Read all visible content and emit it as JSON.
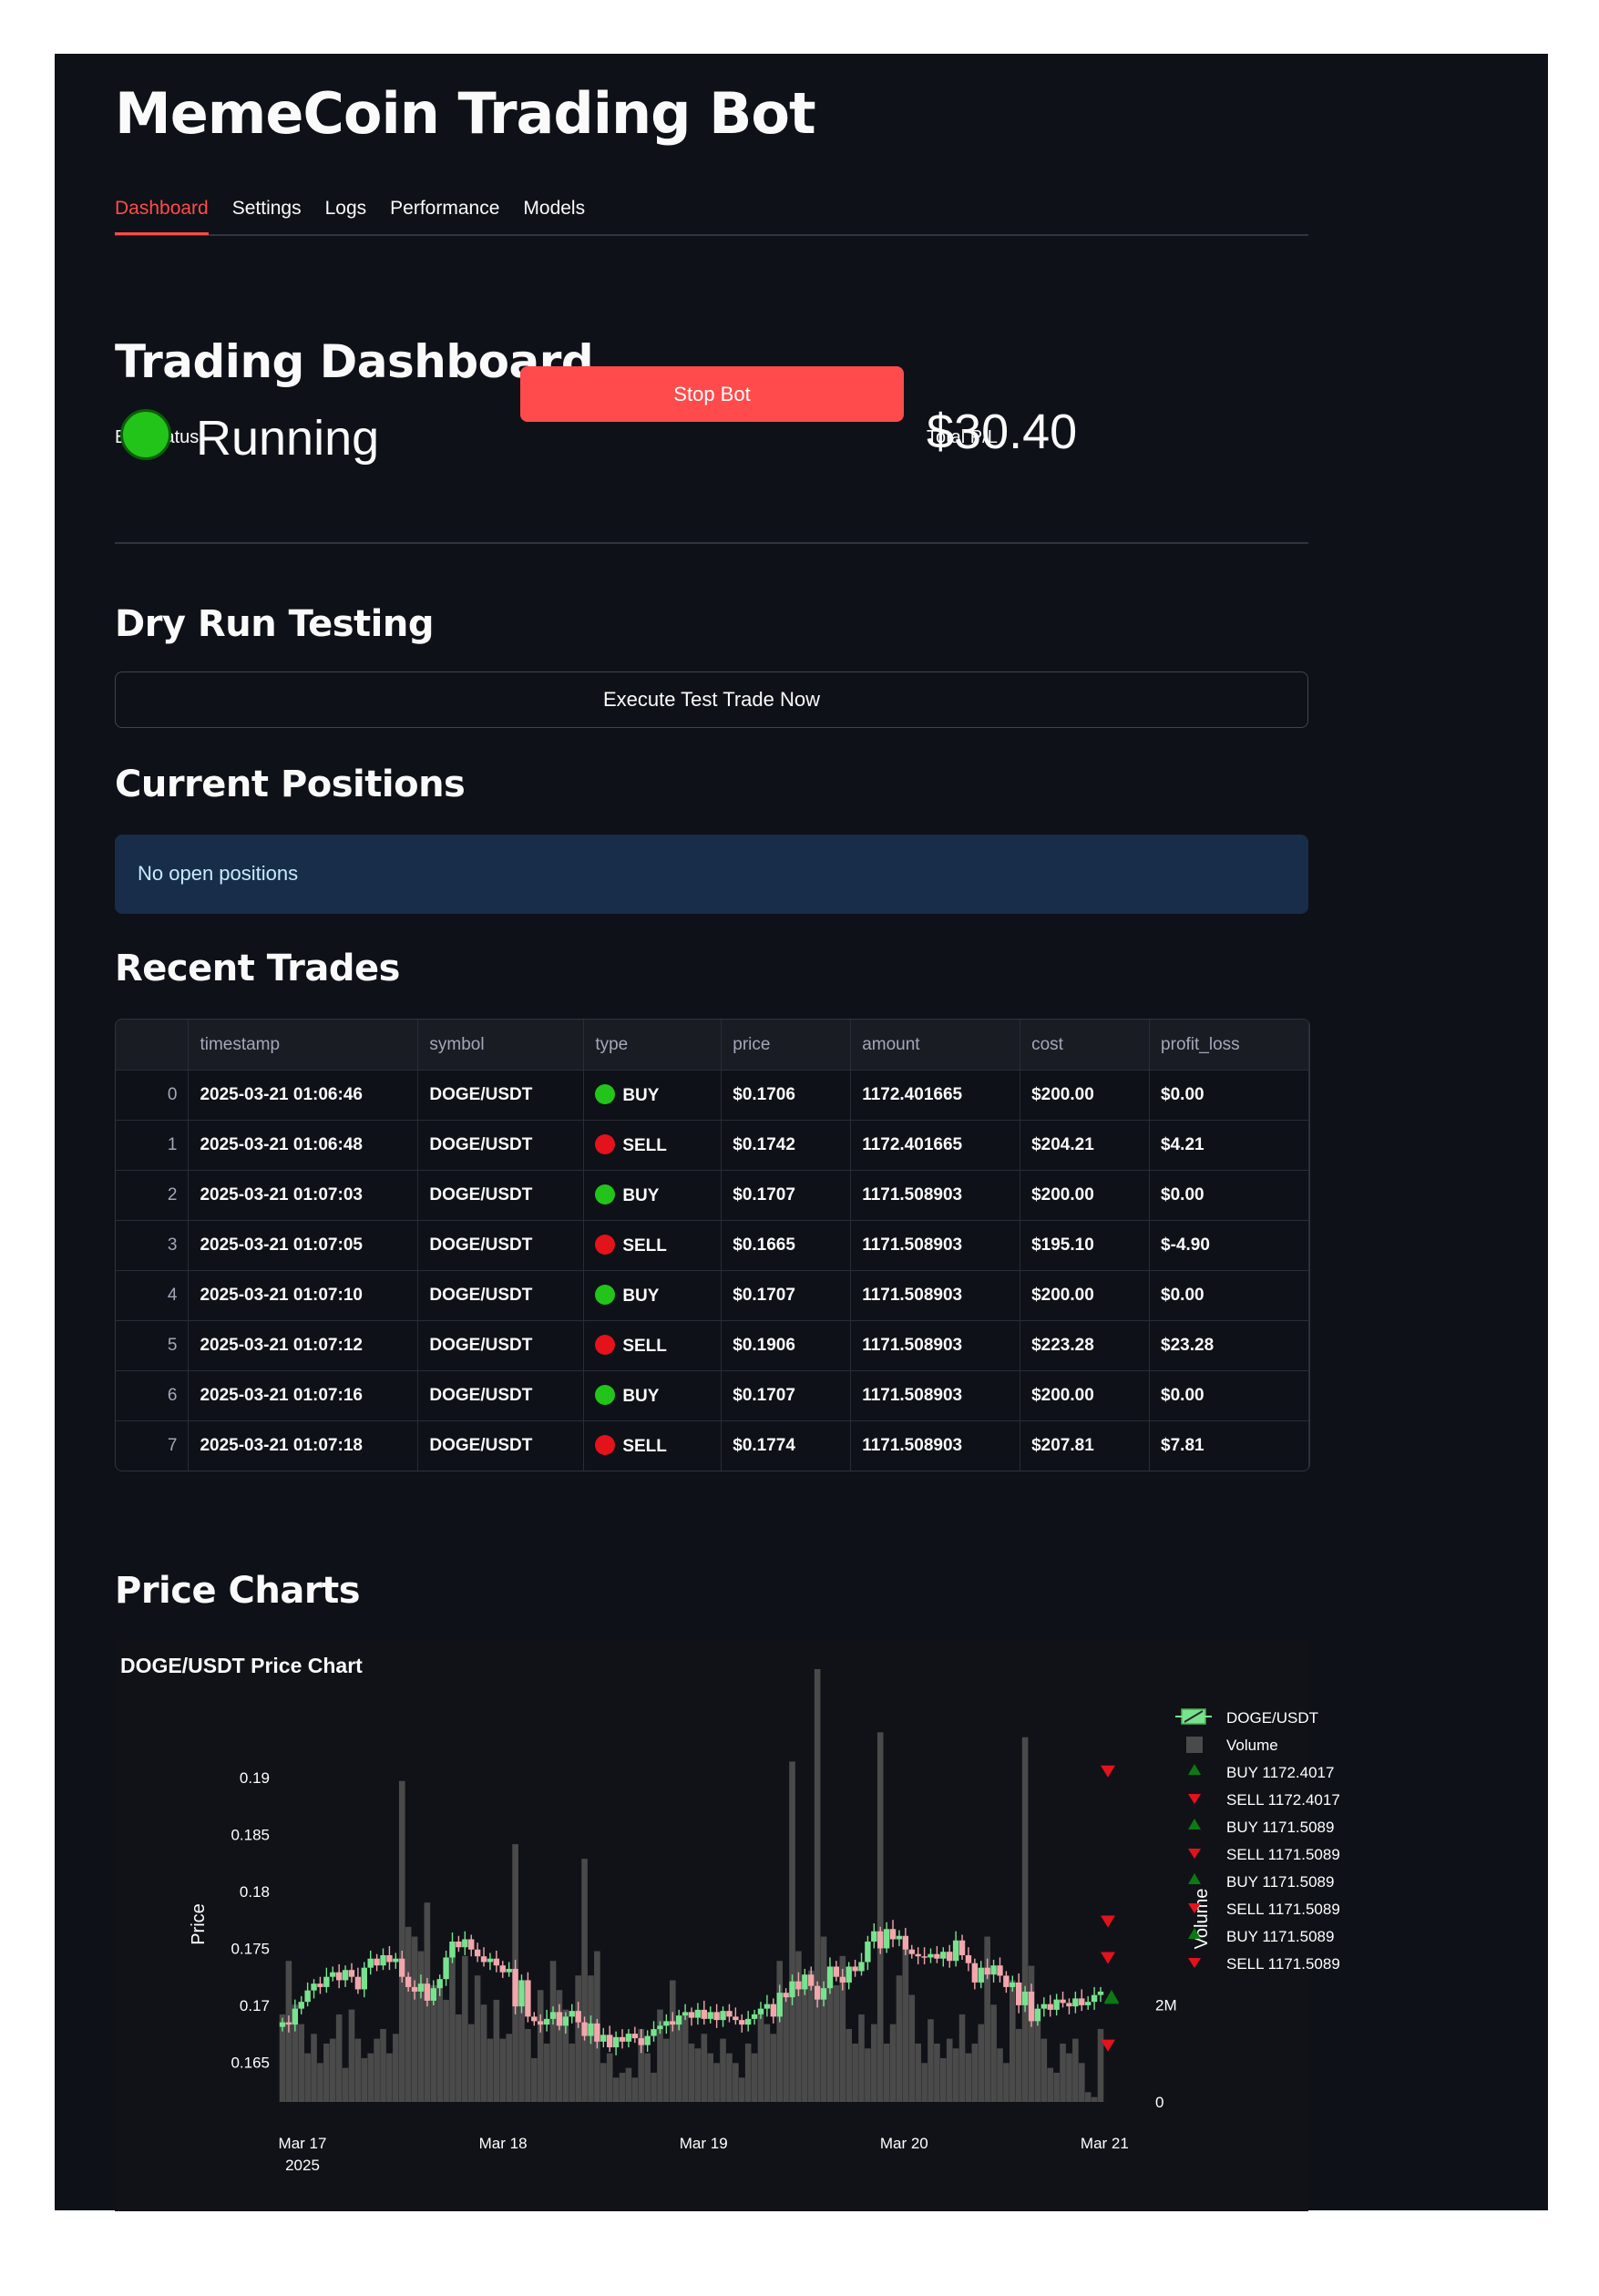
{
  "app": {
    "title": "MemeCoin Trading Bot"
  },
  "tabs": [
    {
      "label": "Dashboard",
      "active": true
    },
    {
      "label": "Settings",
      "active": false
    },
    {
      "label": "Logs",
      "active": false
    },
    {
      "label": "Performance",
      "active": false
    },
    {
      "label": "Models",
      "active": false
    }
  ],
  "dashboard": {
    "heading": "Trading Dashboard",
    "bot_status_label": "Bot Status",
    "bot_status_value": "Running",
    "status_color": "#22c419",
    "stop_button_label": "Stop Bot",
    "total_pl_label": "Total P/L",
    "total_pl_value": "$30.40"
  },
  "dry_run": {
    "heading": "Dry Run Testing",
    "button_label": "Execute Test Trade Now"
  },
  "positions": {
    "heading": "Current Positions",
    "empty_message": "No open positions"
  },
  "trades": {
    "heading": "Recent Trades",
    "columns": [
      "",
      "timestamp",
      "symbol",
      "type",
      "price",
      "amount",
      "cost",
      "profit_loss"
    ],
    "rows": [
      [
        "0",
        "2025-03-21 01:06:46",
        "DOGE/USDT",
        "BUY",
        "$0.1706",
        "1172.401665",
        "$200.00",
        "$0.00"
      ],
      [
        "1",
        "2025-03-21 01:06:48",
        "DOGE/USDT",
        "SELL",
        "$0.1742",
        "1172.401665",
        "$204.21",
        "$4.21"
      ],
      [
        "2",
        "2025-03-21 01:07:03",
        "DOGE/USDT",
        "BUY",
        "$0.1707",
        "1171.508903",
        "$200.00",
        "$0.00"
      ],
      [
        "3",
        "2025-03-21 01:07:05",
        "DOGE/USDT",
        "SELL",
        "$0.1665",
        "1171.508903",
        "$195.10",
        "$-4.90"
      ],
      [
        "4",
        "2025-03-21 01:07:10",
        "DOGE/USDT",
        "BUY",
        "$0.1707",
        "1171.508903",
        "$200.00",
        "$0.00"
      ],
      [
        "5",
        "2025-03-21 01:07:12",
        "DOGE/USDT",
        "SELL",
        "$0.1906",
        "1171.508903",
        "$223.28",
        "$23.28"
      ],
      [
        "6",
        "2025-03-21 01:07:16",
        "DOGE/USDT",
        "BUY",
        "$0.1707",
        "1171.508903",
        "$200.00",
        "$0.00"
      ],
      [
        "7",
        "2025-03-21 01:07:18",
        "DOGE/USDT",
        "SELL",
        "$0.1774",
        "1171.508903",
        "$207.81",
        "$7.81"
      ]
    ],
    "type_colors": {
      "BUY": "#22c419",
      "SELL": "#e3121b"
    }
  },
  "charts": {
    "heading": "Price Charts"
  },
  "chart_data": {
    "type": "candlestick",
    "title": "DOGE/USDT Price Chart",
    "ylabel": "Price",
    "y2label": "Volume",
    "ylim": [
      0.1615,
      0.1925
    ],
    "yticks": [
      0.165,
      0.17,
      0.175,
      0.18,
      0.185,
      0.19
    ],
    "y2ticks": [
      "0",
      "2M"
    ],
    "y2max": 8000000,
    "x_tick_labels": [
      "Mar 17",
      "Mar 18",
      "Mar 19",
      "Mar 20",
      "Mar 21"
    ],
    "x_year_label": "2025",
    "x_range": [
      "2025-03-17 00:00",
      "2025-03-21 02:00"
    ],
    "colors": {
      "up": "#78e38f",
      "down": "#f2a7ad",
      "volume": "#4a4a4a",
      "buy": "#0b7a12",
      "sell": "#e3121b"
    },
    "candle_closes": [
      0.1685,
      0.1683,
      0.1697,
      0.1703,
      0.1713,
      0.1719,
      0.1716,
      0.1725,
      0.1729,
      0.1722,
      0.1731,
      0.1725,
      0.1714,
      0.1733,
      0.1741,
      0.1735,
      0.1744,
      0.1738,
      0.1741,
      0.1725,
      0.1716,
      0.1712,
      0.1719,
      0.1704,
      0.1715,
      0.1723,
      0.1742,
      0.1756,
      0.1751,
      0.1758,
      0.1749,
      0.1743,
      0.1738,
      0.1741,
      0.1735,
      0.1729,
      0.1732,
      0.1699,
      0.1722,
      0.169,
      0.1686,
      0.1683,
      0.1688,
      0.1694,
      0.1682,
      0.169,
      0.1695,
      0.1685,
      0.1673,
      0.1684,
      0.1668,
      0.1674,
      0.1663,
      0.1672,
      0.1668,
      0.1675,
      0.1671,
      0.1665,
      0.1673,
      0.1679,
      0.1682,
      0.1686,
      0.1683,
      0.1691,
      0.1694,
      0.1689,
      0.1696,
      0.1688,
      0.1694,
      0.1687,
      0.1695,
      0.169,
      0.1687,
      0.1683,
      0.1688,
      0.1692,
      0.1697,
      0.1701,
      0.169,
      0.1711,
      0.1707,
      0.1721,
      0.1714,
      0.1727,
      0.1717,
      0.1705,
      0.1715,
      0.1734,
      0.1725,
      0.172,
      0.1734,
      0.173,
      0.1738,
      0.1756,
      0.1765,
      0.175,
      0.1767,
      0.1758,
      0.1761,
      0.1749,
      0.1745,
      0.1743,
      0.1742,
      0.1745,
      0.1741,
      0.1747,
      0.1739,
      0.1757,
      0.1744,
      0.1737,
      0.172,
      0.1733,
      0.1727,
      0.1735,
      0.1726,
      0.1716,
      0.172,
      0.17,
      0.1712,
      0.1686,
      0.1697,
      0.1701,
      0.1696,
      0.1705,
      0.1702,
      0.1699,
      0.1706,
      0.17,
      0.1703,
      0.1709,
      0.1712
    ],
    "volumes_m": [
      1.8,
      2.9,
      2.0,
      1.6,
      1.0,
      1.4,
      0.8,
      1.2,
      1.3,
      1.8,
      0.7,
      1.9,
      1.3,
      0.9,
      1.0,
      1.3,
      1.5,
      1.0,
      1.4,
      6.6,
      3.6,
      3.4,
      3.1,
      4.1,
      2.4,
      2.4,
      2.1,
      3.2,
      1.8,
      3.0,
      1.6,
      2.6,
      2.0,
      1.3,
      2.1,
      1.3,
      1.4,
      5.3,
      2.3,
      1.5,
      0.9,
      2.3,
      1.2,
      2.9,
      2.3,
      1.9,
      1.2,
      2.6,
      5.0,
      2.6,
      3.1,
      0.8,
      1.0,
      0.5,
      0.6,
      0.7,
      0.5,
      1.5,
      1.0,
      0.6,
      1.9,
      1.3,
      2.5,
      1.6,
      1.8,
      1.2,
      1.1,
      1.4,
      1.0,
      0.8,
      1.3,
      1.0,
      0.8,
      0.5,
      1.2,
      1.0,
      1.8,
      1.6,
      1.4,
      2.9,
      2.2,
      7.0,
      3.1,
      2.4,
      2.7,
      8.9,
      3.4,
      2.7,
      2.4,
      3.0,
      1.5,
      1.2,
      1.8,
      1.1,
      1.6,
      7.6,
      1.2,
      1.6,
      2.6,
      3.2,
      2.2,
      1.2,
      0.8,
      1.7,
      1.2,
      0.9,
      1.3,
      1.1,
      1.8,
      1.0,
      1.2,
      1.6,
      3.4,
      2.0,
      1.1,
      0.8,
      2.5,
      1.5,
      7.5,
      2.8,
      1.9,
      1.3,
      0.7,
      0.6,
      1.2,
      1.0,
      1.3,
      0.8,
      0.2,
      0.1,
      1.5
    ],
    "trade_markers": [
      {
        "type": "BUY",
        "price": 0.1706
      },
      {
        "type": "SELL",
        "price": 0.1742
      },
      {
        "type": "BUY",
        "price": 0.1707
      },
      {
        "type": "SELL",
        "price": 0.1665
      },
      {
        "type": "BUY",
        "price": 0.1707
      },
      {
        "type": "SELL",
        "price": 0.1906
      },
      {
        "type": "BUY",
        "price": 0.1707
      },
      {
        "type": "SELL",
        "price": 0.1774
      }
    ],
    "legend": [
      "DOGE/USDT",
      "Volume",
      "BUY 1172.4017",
      "SELL 1172.4017",
      "BUY 1171.5089",
      "SELL 1171.5089",
      "BUY 1171.5089",
      "SELL 1171.5089",
      "BUY 1171.5089",
      "SELL 1171.5089"
    ],
    "legend_position": "right"
  }
}
